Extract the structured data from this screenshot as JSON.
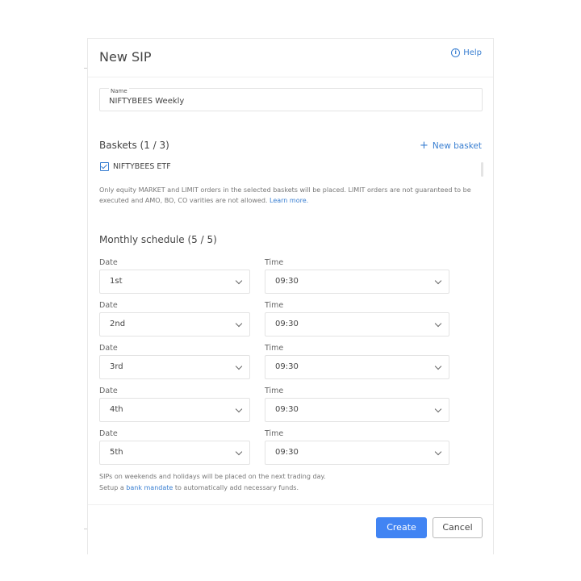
{
  "header": {
    "title": "New SIP",
    "help_label": "Help"
  },
  "name_field": {
    "label": "Name",
    "value": "NIFTYBEES Weekly"
  },
  "baskets": {
    "title": "Baskets (1 / 3)",
    "new_basket_label": "New basket",
    "items": [
      {
        "label": "NIFTYBEES ETF",
        "checked": true
      }
    ],
    "note": "Only equity MARKET and LIMIT orders in the selected baskets will be placed. LIMIT orders are not guaranteed to be executed and AMO, BO, CO varities are not allowed.",
    "learn_more": "Learn more."
  },
  "schedule": {
    "title": "Monthly schedule (5 / 5)",
    "date_label": "Date",
    "time_label": "Time",
    "rows": [
      {
        "date": "1st",
        "time": "09:30"
      },
      {
        "date": "2nd",
        "time": "09:30"
      },
      {
        "date": "3rd",
        "time": "09:30"
      },
      {
        "date": "4th",
        "time": "09:30"
      },
      {
        "date": "5th",
        "time": "09:30"
      }
    ]
  },
  "footnote": {
    "line1": "SIPs on weekends and holidays will be placed on the next trading day.",
    "line2_prefix": "Setup a",
    "line2_link": "bank mandate",
    "line2_suffix": "to automatically add necessary funds."
  },
  "footer": {
    "create_label": "Create",
    "cancel_label": "Cancel"
  },
  "colors": {
    "accent": "#387ed1",
    "primary_button": "#4184f3"
  },
  "icons": {
    "help": "info-circle-icon",
    "add": "plus-icon",
    "dropdown": "chevron-down-icon",
    "checkbox": "check-icon"
  }
}
